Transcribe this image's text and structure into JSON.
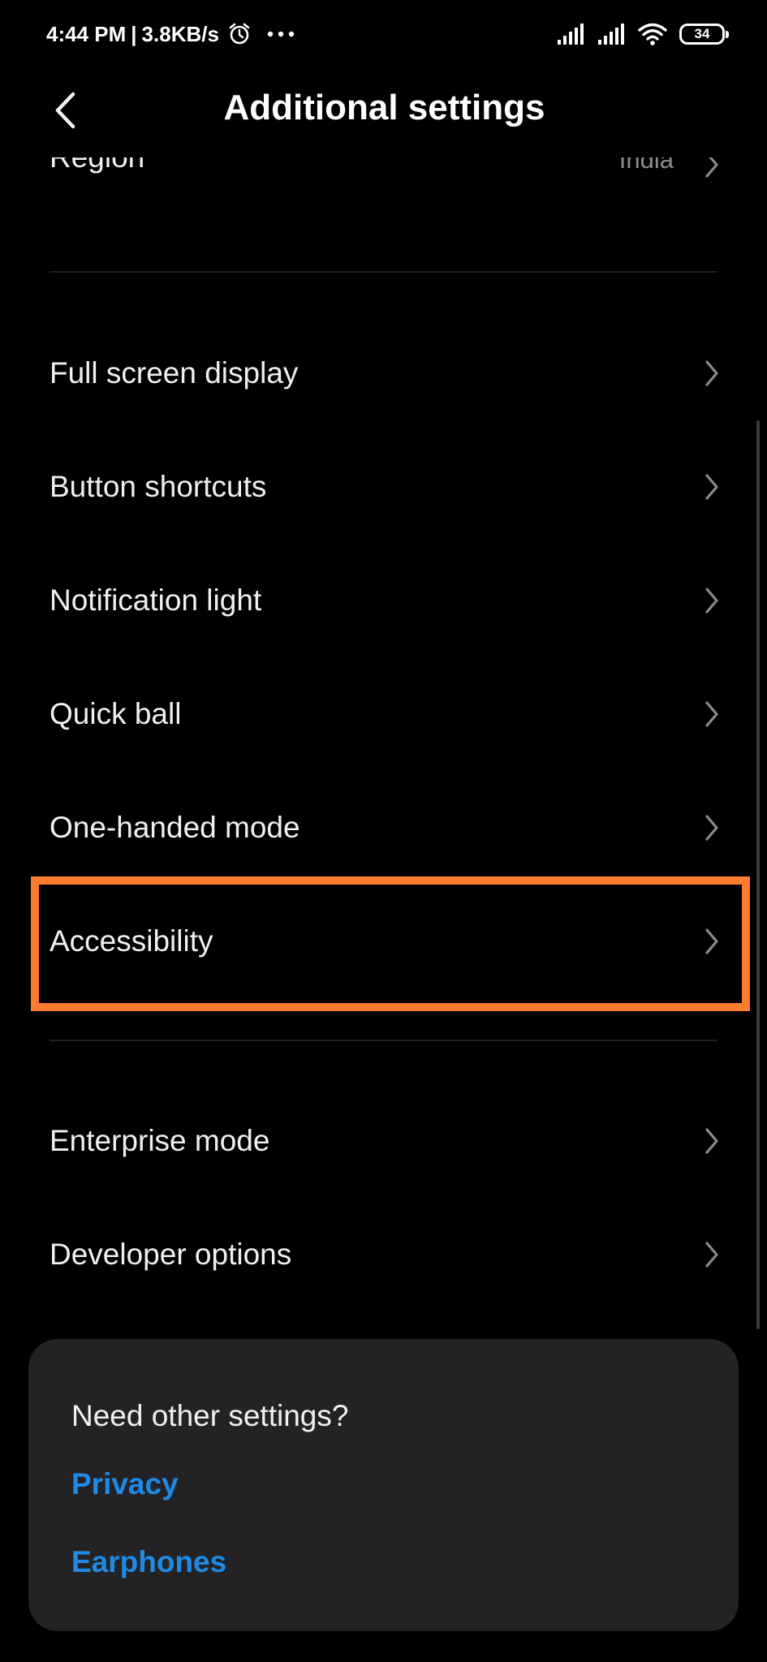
{
  "status_bar": {
    "time": "4:44 PM",
    "separator": "|",
    "net_speed": "3.8KB/s",
    "battery_level": "34",
    "icons": [
      "alarm-icon",
      "more-dots-icon",
      "signal-icon",
      "signal-icon",
      "wifi-icon",
      "battery-icon"
    ]
  },
  "header": {
    "title": "Additional settings",
    "back_icon": "back-arrow-icon"
  },
  "list": {
    "region": {
      "label": "Region",
      "value": "India"
    },
    "items": [
      {
        "label": "Full screen display"
      },
      {
        "label": "Button shortcuts"
      },
      {
        "label": "Notification light"
      },
      {
        "label": "Quick ball"
      },
      {
        "label": "One-handed mode"
      },
      {
        "label": "Accessibility"
      },
      {
        "label": "Enterprise mode"
      },
      {
        "label": "Developer options"
      }
    ],
    "highlighted_item": "Accessibility"
  },
  "card": {
    "title": "Need other settings?",
    "links": [
      "Privacy",
      "Earphones"
    ]
  },
  "colors": {
    "background": "#000000",
    "highlight_border": "#fe7b2f",
    "link": "#1e8ae6",
    "card_background": "#232325",
    "secondary_text": "#8d8d8d"
  }
}
